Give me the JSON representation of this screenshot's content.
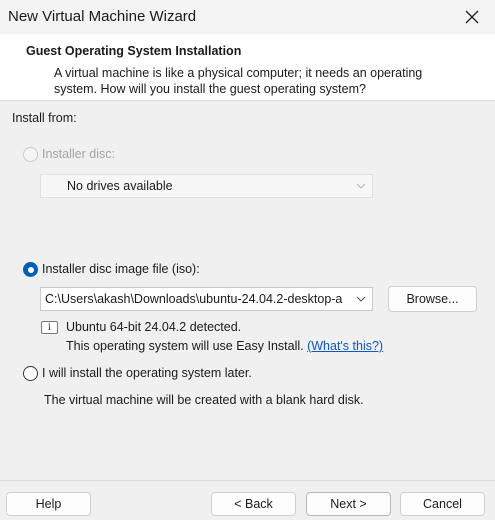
{
  "window": {
    "title": "New Virtual Machine Wizard"
  },
  "header": {
    "title": "Guest Operating System Installation",
    "description": "A virtual machine is like a physical computer; it needs an operating system. How will you install the guest operating system?"
  },
  "install_from": {
    "label": "Install from:",
    "installer_disc": {
      "label": "Installer disc:",
      "selected": false,
      "enabled": false,
      "dropdown_value": "No drives available"
    },
    "iso": {
      "label": "Installer disc image file (iso):",
      "selected": true,
      "path": "C:\\Users\\akash\\Downloads\\ubuntu-24.04.2-desktop-a",
      "browse_label": "Browse...",
      "detected_line": "Ubuntu 64-bit 24.04.2 detected.",
      "easy_install_line": "This operating system will use Easy Install.",
      "whats_this_link": "(What's this?)"
    },
    "later": {
      "label": "I will install the operating system later.",
      "selected": false,
      "description": "The virtual machine will be created with a blank hard disk."
    }
  },
  "footer": {
    "help": "Help",
    "back": "< Back",
    "next": "Next >",
    "cancel": "Cancel"
  },
  "colors": {
    "accent": "#005fb8",
    "link": "#0a58ca"
  },
  "icons": {
    "close": "close-icon",
    "info": "info-icon",
    "dropdown": "chevron-down-icon"
  }
}
